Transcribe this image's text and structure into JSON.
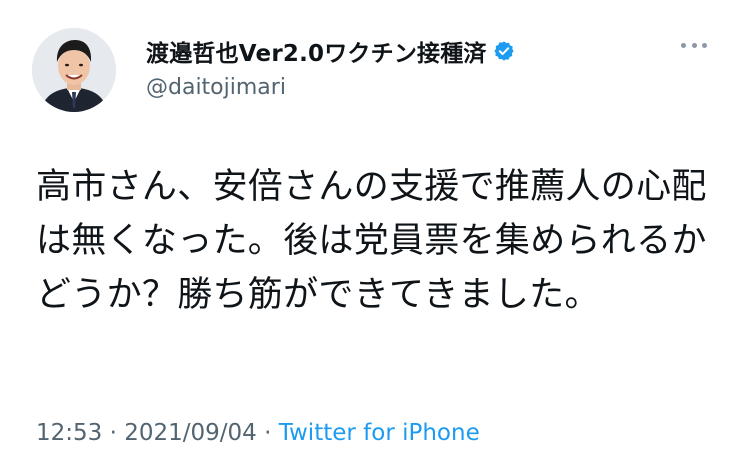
{
  "author": {
    "display_name": "渡邉哲也Ver2.0ワクチン接種済",
    "handle": "@daitojimari",
    "verified_icon": "verified-badge-icon",
    "verified_color": "#1d9bf0"
  },
  "tweet": {
    "text": "高市さん、安倍さんの支援で推薦人の心配は無くなった。後は党員票を集められるかどうか？勝ち筋ができてきました。"
  },
  "meta": {
    "time": "12:53",
    "separator": " · ",
    "date": "2021/09/04",
    "source": "Twitter for iPhone"
  },
  "colors": {
    "text": "#0f1419",
    "secondary": "#536471",
    "link": "#1d9bf0"
  }
}
